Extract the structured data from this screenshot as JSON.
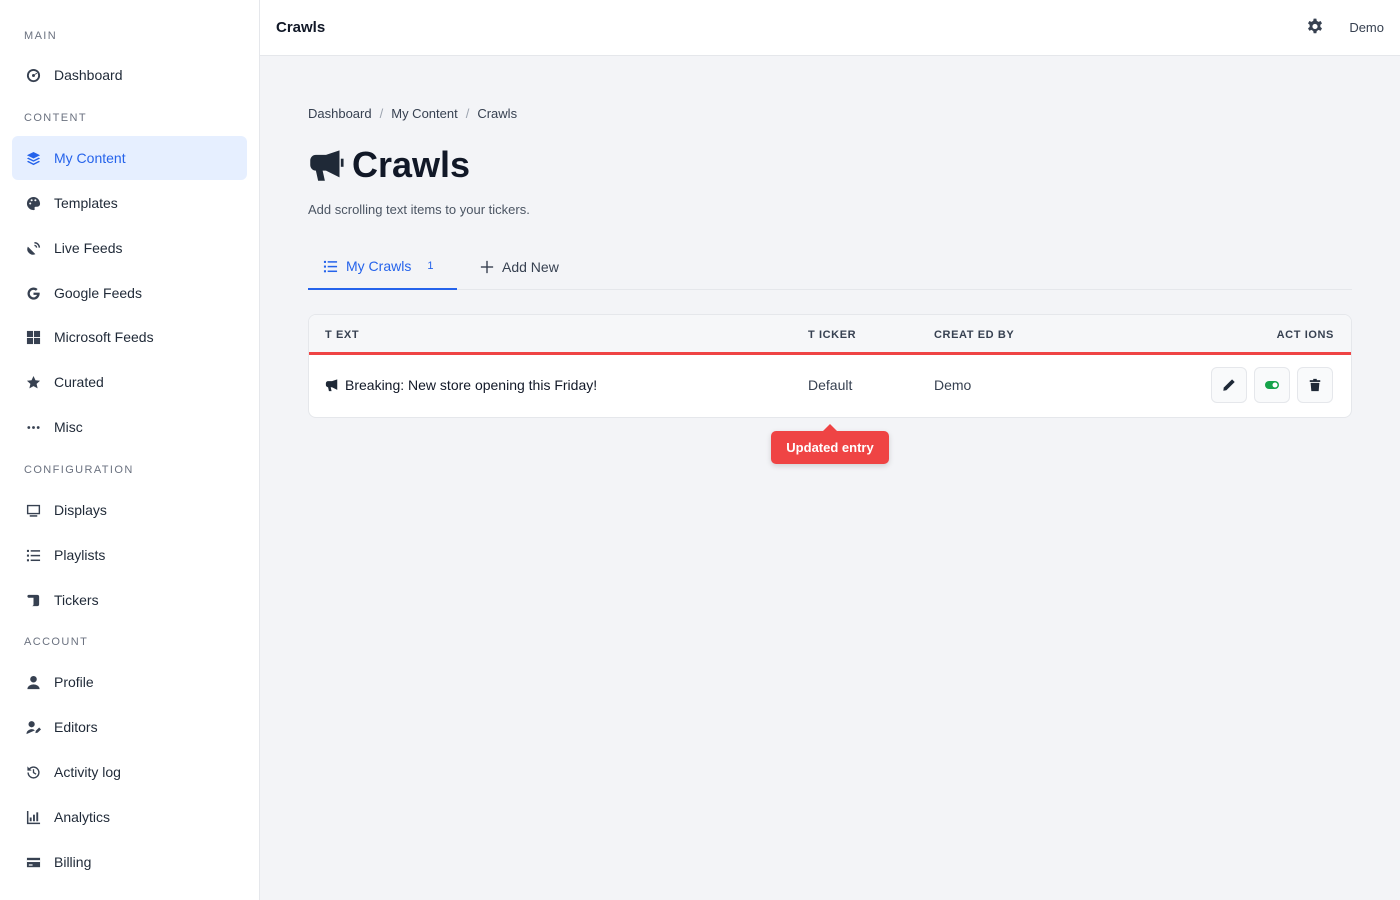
{
  "sidebar": {
    "sections": {
      "main": "MAIN",
      "content": "CONTENT",
      "configuration": "CONFIGURATION",
      "account": "ACCOUNT"
    },
    "items": {
      "dashboard": "Dashboard",
      "my_content": "My Content",
      "templates": "Templates",
      "live_feeds": "Live Feeds",
      "google_feeds": "Google Feeds",
      "microsoft_feeds": "Microsoft Feeds",
      "curated": "Curated",
      "misc": "Misc",
      "displays": "Displays",
      "playlists": "Playlists",
      "tickers": "Tickers",
      "profile": "Profile",
      "editors": "Editors",
      "activity_log": "Activity log",
      "analytics": "Analytics",
      "billing": "Billing"
    },
    "active_item": "my_content"
  },
  "topbar": {
    "title": "Crawls",
    "user": "Demo"
  },
  "breadcrumb": [
    "Dashboard",
    "My Content",
    "Crawls"
  ],
  "breadcrumb_separator": "/",
  "page": {
    "title": "Crawls",
    "subtitle": "Add scrolling text items to your tickers."
  },
  "tabs": {
    "my_crawls": "My Crawls",
    "my_crawls_count": "1",
    "add_new": "Add New"
  },
  "table": {
    "headers": {
      "text": "T EXT",
      "ticker": "T ICKER",
      "created_by": "CREAT ED BY",
      "actions": "ACT IONS"
    },
    "rows": [
      {
        "text": "Breaking: New store opening this Friday!",
        "ticker": "Default",
        "created_by": "Demo",
        "enabled": true
      }
    ]
  },
  "tooltip": "Updated entry",
  "colors": {
    "accent": "#2563eb",
    "danger": "#ef4444",
    "toggle_on": "#16a34a"
  }
}
